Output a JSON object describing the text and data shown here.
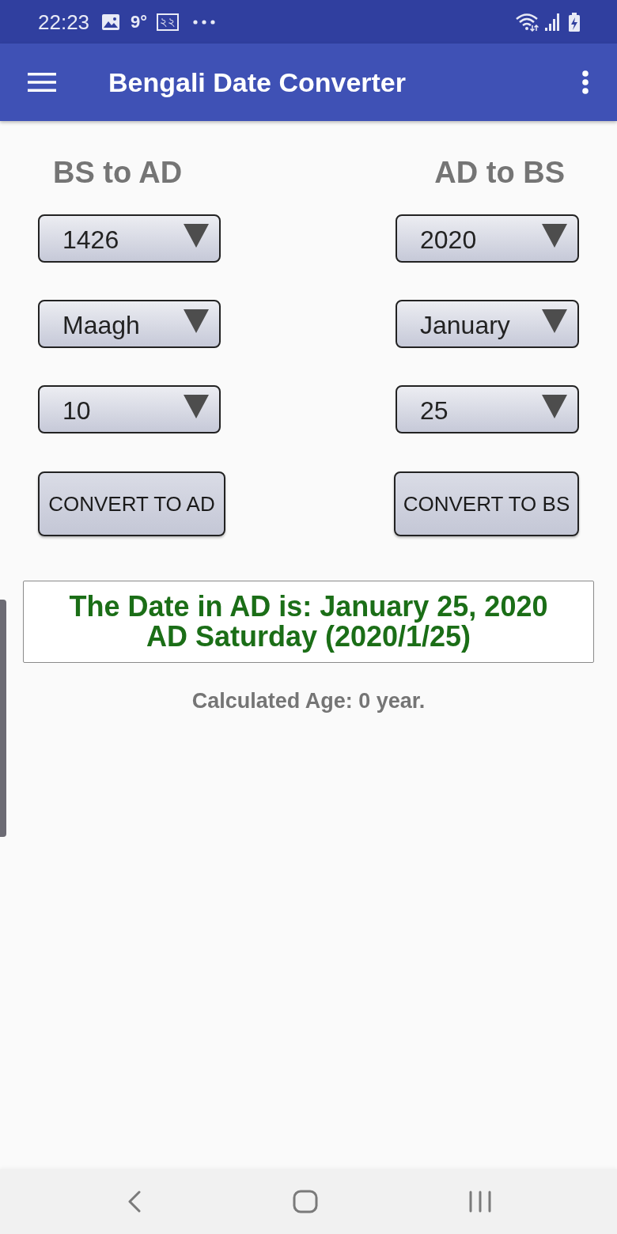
{
  "status_bar": {
    "time": "22:23",
    "weather": "9°",
    "date_badge": "২২"
  },
  "app_bar": {
    "title": "Bengali Date Converter"
  },
  "converters": [
    {
      "title": "BS to AD",
      "fields": [
        {
          "value": "1426"
        },
        {
          "value": "Maagh"
        },
        {
          "value": "10"
        }
      ],
      "button": "CONVERT TO AD"
    },
    {
      "title": "AD to BS",
      "fields": [
        {
          "value": "2020"
        },
        {
          "value": "January"
        },
        {
          "value": "25"
        }
      ],
      "button": "CONVERT TO BS"
    }
  ],
  "result": "The Date in AD is: January 25, 2020 AD Saturday (2020/1/25)",
  "age": "Calculated Age: 0 year."
}
